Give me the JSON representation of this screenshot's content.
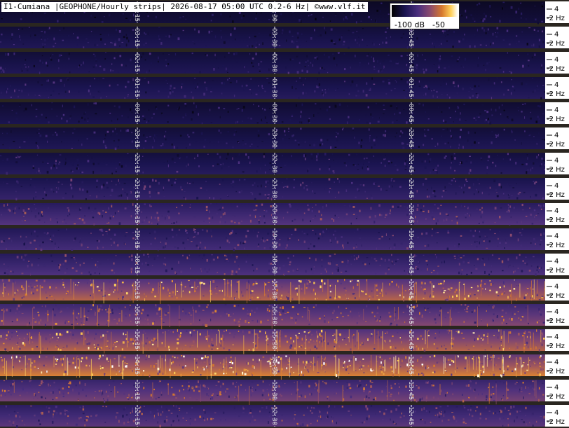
{
  "header": {
    "title": "I1-Cumiana |GEOPHONE/Hourly strips| 2026-08-17 05:00 UTC 0.2-6 Hz| ©www.vlf.it"
  },
  "colorbar": {
    "label_low": "-100 dB",
    "label_high": "-50",
    "colors": [
      "#000000",
      "#1a1450",
      "#4a2f7e",
      "#8a4a6e",
      "#d6782e",
      "#ffd15a",
      "#ffffff"
    ]
  },
  "chart_data": {
    "type": "heatmap",
    "title": "I1-Cumiana |GEOPHONE/Hourly strips| 2026-08-17 05:00 UTC 0.2-6 Hz| ©www.vlf.it",
    "x_unit": "time (UTC, 1 hour per strip)",
    "y_unit": "Hz",
    "y_range": [
      0.2,
      6
    ],
    "y_ticks": [
      "4",
      "2 Hz"
    ],
    "color_range_db": [
      -100,
      -50
    ],
    "strips": [
      {
        "markers": [
          "04:15",
          "04:30",
          "04:45"
        ],
        "intensity": 0.12
      },
      {
        "markers": [
          "03:15",
          "03:30",
          "03:45"
        ],
        "intensity": 0.18
      },
      {
        "markers": [
          "02:15",
          "02:30",
          "02:45"
        ],
        "intensity": 0.18
      },
      {
        "markers": [
          "01:15",
          "01:30",
          "01:45"
        ],
        "intensity": 0.2
      },
      {
        "markers": [
          "00:15",
          "00:30",
          "00:45"
        ],
        "intensity": 0.16
      },
      {
        "markers": [
          "23:15",
          "23:30",
          "23:45"
        ],
        "intensity": 0.18
      },
      {
        "markers": [
          "22:15",
          "22:30",
          "22:45"
        ],
        "intensity": 0.2
      },
      {
        "markers": [
          "21:15",
          "21:30",
          "21:45"
        ],
        "intensity": 0.25
      },
      {
        "markers": [
          "20:15",
          "20:30",
          "20:45"
        ],
        "intensity": 0.34
      },
      {
        "markers": [
          "19:15",
          "19:30",
          "19:45"
        ],
        "intensity": 0.3
      },
      {
        "markers": [
          "18:15",
          "18:30",
          "18:45"
        ],
        "intensity": 0.33
      },
      {
        "markers": [
          "17:15",
          "17:30",
          "17:45"
        ],
        "intensity": 0.55
      },
      {
        "markers": [
          "16:15",
          "16:30",
          "16:45"
        ],
        "intensity": 0.45
      },
      {
        "markers": [
          "15:15",
          "15:30",
          "15:45"
        ],
        "intensity": 0.55
      },
      {
        "markers": [
          "14:15",
          "14:30",
          "14:45"
        ],
        "intensity": 0.62
      },
      {
        "markers": [
          "13:15",
          "13:30",
          "13:45"
        ],
        "intensity": 0.42
      },
      {
        "markers": [
          "12:15",
          "12:30",
          "12:45"
        ],
        "intensity": 0.36
      }
    ]
  }
}
